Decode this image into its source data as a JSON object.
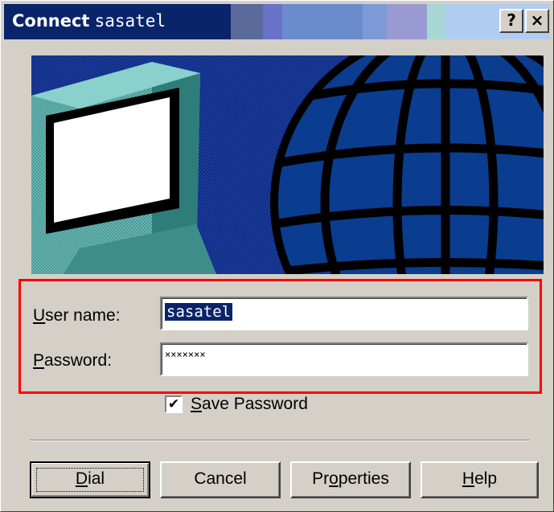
{
  "window": {
    "title_prefix": "Connect",
    "title_name": "sasatel",
    "help_button": "?",
    "close_button": "×"
  },
  "form": {
    "username_label_accel": "U",
    "username_label_rest": "ser name:",
    "username_value": "sasatel",
    "password_label_accel": "P",
    "password_label_rest": "assword:",
    "password_value": "×××××××",
    "save_password_accel": "S",
    "save_password_rest": "ave Password",
    "save_password_checked": "✔"
  },
  "buttons": {
    "dial_accel": "D",
    "dial_rest": "ial",
    "cancel": "Cancel",
    "properties_pre": "Pr",
    "properties_accel": "o",
    "properties_post": "perties",
    "help_accel": "H",
    "help_rest": "elp"
  },
  "colors": {
    "title_bar": "#0a246a",
    "highlight_frame": "#ff0000",
    "globe_blue": "#0a3d8f"
  },
  "icons": {
    "banner": "computer-monitor-and-globe"
  }
}
